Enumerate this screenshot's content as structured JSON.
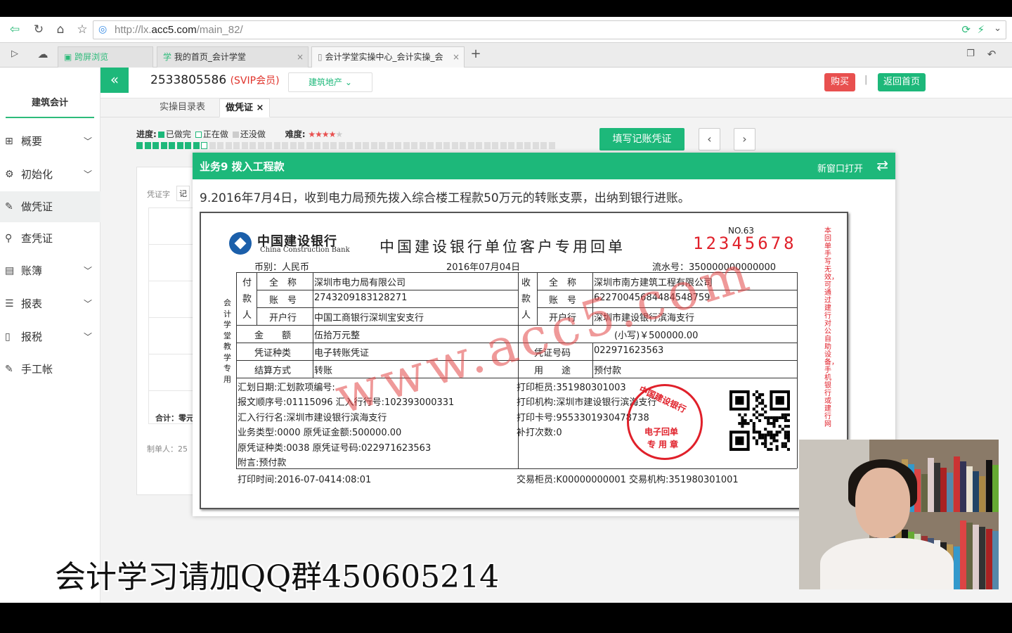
{
  "browser": {
    "url_prefix": "http://lx.",
    "url_host": "acc5.com",
    "url_path": "/main_82/",
    "tabs": [
      {
        "label": "跨屏浏览"
      },
      {
        "label": "我的首页_会计学堂"
      },
      {
        "label": "会计学堂实操中心_会计实操_会"
      }
    ]
  },
  "sidebar": {
    "brand": "建筑会计",
    "items": [
      {
        "label": "概要",
        "icon": "grid-icon"
      },
      {
        "label": "初始化",
        "icon": "gear-icon"
      },
      {
        "label": "做凭证",
        "icon": "pen-icon"
      },
      {
        "label": "查凭证",
        "icon": "search-icon"
      },
      {
        "label": "账簿",
        "icon": "book-icon"
      },
      {
        "label": "报表",
        "icon": "report-icon"
      },
      {
        "label": "报税",
        "icon": "file-icon"
      },
      {
        "label": "手工帐",
        "icon": "pen-icon"
      }
    ]
  },
  "header": {
    "collapse": "«",
    "user_id": "2533805586",
    "membership": "(SVIP会员)",
    "industry": "建筑地产",
    "buy": "购买",
    "separator": "|",
    "home": "返回首页"
  },
  "page_tabs": [
    {
      "label": "实操目录表"
    },
    {
      "label": "做凭证",
      "close": "×"
    }
  ],
  "progress": {
    "label": "进度:",
    "done": "已做完",
    "doing": "正在做",
    "todo": "还没做",
    "difficulty_label": "难度:",
    "difficulty_stars": 4,
    "difficulty_max": 5,
    "done_count": 8,
    "current_index": 9,
    "total": 52,
    "done_color": "#1db87a"
  },
  "actions": {
    "fill_voucher": "填写记账凭证",
    "prev": "‹",
    "next": "›"
  },
  "bg_form": {
    "voucher_char": "凭证字",
    "voucher_val": "记",
    "total_label": "合计：零元",
    "maker": "制单人：25"
  },
  "popup": {
    "title": "业务9 拨入工程款",
    "open_new": "新窗口打开",
    "description": "9.2016年7月4日，收到电力局预先拨入综合楼工程款50万元的转账支票，出纳到银行进账。"
  },
  "receipt": {
    "bank_cn": "中国建设银行",
    "bank_en": "China Construction Bank",
    "title": "中国建设银行单位客户专用回单",
    "no_label": "NO.63",
    "no_value": "12345678",
    "side_note": "本回单手写无效，可通过建行对公自助设备，手机银行或建行网",
    "vertical_label": "会计学堂教学专用",
    "currency": "币别：人民币",
    "date": "2016年07月04日",
    "serial": "流水号：350000000000000",
    "payer_label": [
      "付",
      "款",
      "人"
    ],
    "payee_label": [
      "收",
      "款",
      "人"
    ],
    "full_name_label": "全　称",
    "account_label": "账　号",
    "bank_label": "开户行",
    "payer_name": "深圳市电力局有限公司",
    "payer_account": "2743209183128271",
    "payer_bank": "中国工商银行深圳宝安支行",
    "payee_name": "深圳市南方建筑工程有限公司",
    "payee_account": "6227004568448454875 9",
    "payee_account_clean": "62270045684484548759",
    "payee_bank": "深圳市建设银行滨海支行",
    "amount_label": "金　　额",
    "amount_words": "伍拾万元整",
    "amount_small": "(小写)￥500000.00",
    "voucher_type_label": "凭证种类",
    "voucher_type": "电子转账凭证",
    "voucher_no_label": "凭证号码",
    "voucher_no": "022971623563",
    "settle_label": "结算方式",
    "settle": "转账",
    "usage_label": "用　　途",
    "usage": "预付款",
    "remit_date": "汇划日期:汇划款项编号:",
    "msg_seq": "报文顺序号:01115096 汇入行行号:102393000331",
    "remit_bank": "汇入行行名:深圳市建设银行滨海支行",
    "biz_type": "业务类型:0000 原凭证金额:500000.00",
    "orig_type": "原凭证种类:0038 原凭证号码:022971623563",
    "postscript": "附言:预付款",
    "print_teller": "打印柜员:351980301003",
    "print_org": "打印机构:深圳市建设银行滨海支行",
    "print_card": "打印卡号:9553301930478738",
    "reprint": "补打次数:0",
    "print_time": "打印时间:2016-07-0414:08:01",
    "trade_teller": "交易柜员:K00000000001 交易机构:351980301001",
    "watermark": "www.acc5.com",
    "stamp_top": "中国建设银行",
    "stamp_line1": "电子回单",
    "stamp_line2": "专用章"
  },
  "overlay": {
    "qq_text": "会计学习请加QQ群450605214"
  }
}
